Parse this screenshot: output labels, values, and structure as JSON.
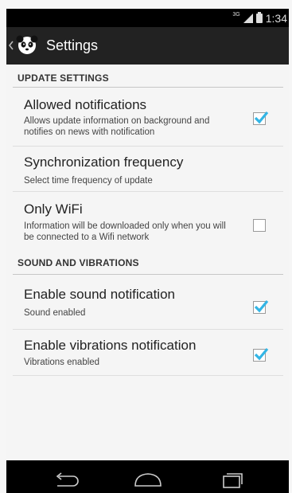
{
  "status_bar": {
    "network_label": "3G",
    "time": "1:34"
  },
  "action_bar": {
    "title": "Settings",
    "back_icon": "chevron-left-icon",
    "app_icon": "panda-icon"
  },
  "sections": [
    {
      "header": "UPDATE SETTINGS",
      "items": [
        {
          "title": "Allowed notifications",
          "summary": "Allows update information on background and notifies on news with notification",
          "checked": true
        },
        {
          "title": "Synchronization frequency",
          "summary": "Select time frequency of update",
          "checked": null
        },
        {
          "title": "Only WiFi",
          "summary": "Information will be downloaded only when you will be connected to a Wifi network",
          "checked": false
        }
      ]
    },
    {
      "header": "SOUND AND VIBRATIONS",
      "items": [
        {
          "title": "Enable sound notification",
          "summary": "Sound enabled",
          "checked": true
        },
        {
          "title": "Enable vibrations notification",
          "summary": "Vibrations enabled",
          "checked": true
        }
      ]
    }
  ],
  "navigation_bar": {
    "buttons": [
      "back-icon",
      "home-icon",
      "recents-icon"
    ]
  },
  "colors": {
    "accent": "#33b5e5",
    "action_bar": "#222222",
    "background": "#f5f5f5"
  }
}
